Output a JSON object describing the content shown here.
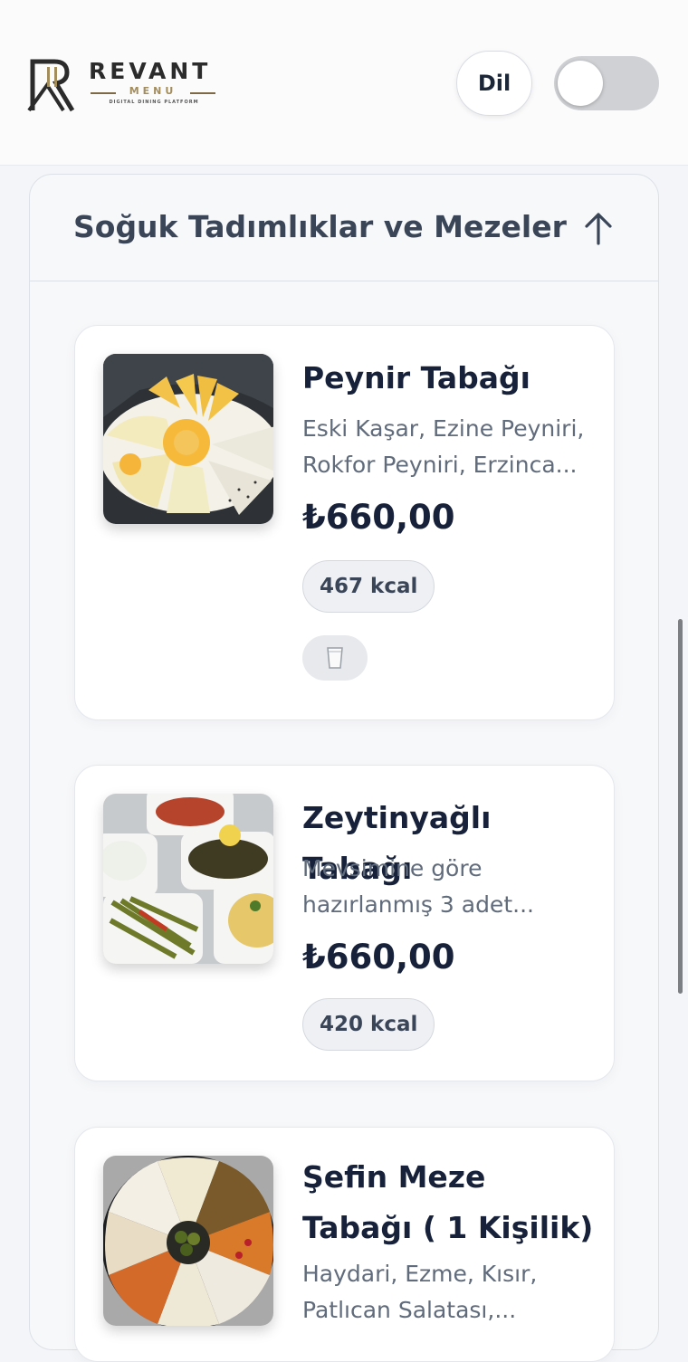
{
  "header": {
    "brand": {
      "name": "REVANT",
      "sub": "MENU",
      "tagline": "DIGITAL DINING PLATFORM"
    },
    "language_button": "Dil",
    "theme_toggle": {
      "on": false
    }
  },
  "category": {
    "title": "Soğuk Tadımlıklar ve Mezeler",
    "collapse_icon": "arrow-up-icon",
    "items": [
      {
        "name": "Peynir Tabağı",
        "description": "Eski Kaşar, Ezine Peyniri, Rokfor Peyniri, Erzinca...",
        "price": "₺660,00",
        "kcal": "467 kcal",
        "allergen_icon": "milk-glass-icon"
      },
      {
        "name": "Zeytinyağlı Tabağı",
        "description": "Mevsimine göre hazırlanmış 3 adet...",
        "price": "₺660,00",
        "kcal": "420 kcal"
      },
      {
        "name": "Şefin Meze Tabağı ( 1 Kişilik)",
        "description": "Haydari, Ezme, Kısır, Patlıcan Salatası,..."
      }
    ]
  },
  "colors": {
    "text_dark": "#17223a",
    "text_muted": "#606b7b",
    "accent_gold": "#a38d5c",
    "toggle_off": "#cfd1d4"
  }
}
